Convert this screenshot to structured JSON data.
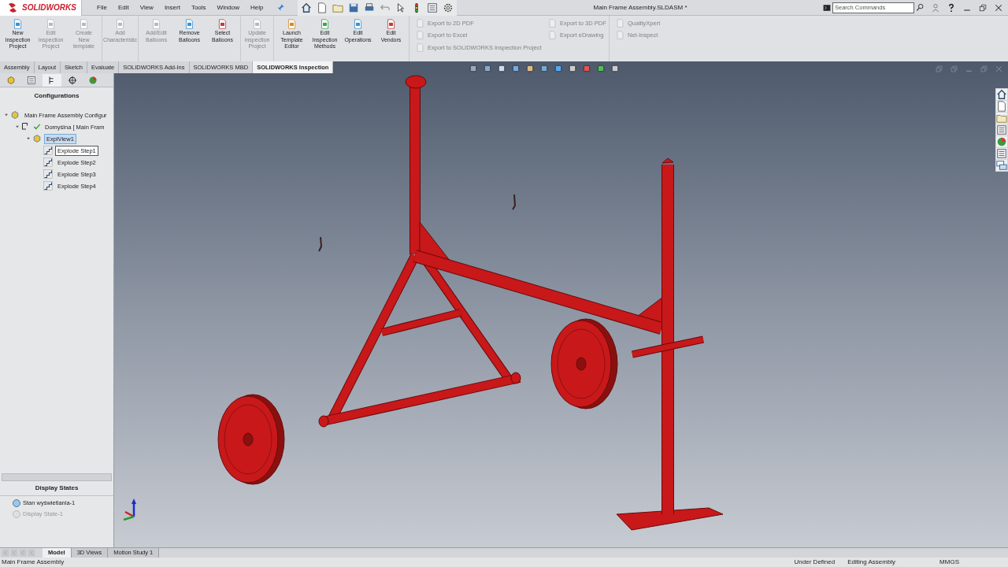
{
  "logo": "SOLIDWORKS",
  "menu": [
    "File",
    "Edit",
    "View",
    "Insert",
    "Tools",
    "Window",
    "Help"
  ],
  "title": "Main Frame Assembly.SLDASM *",
  "search": {
    "placeholder": "Search Commands"
  },
  "ribbon": {
    "buttons": [
      {
        "label": "New\nInspection\nProject",
        "disabled": false
      },
      {
        "label": "Edit\nInspection\nProject",
        "disabled": true
      },
      {
        "label": "Create\nNew\ntemplate",
        "disabled": true
      },
      {
        "label": "Add\nCharacteristic",
        "disabled": true
      },
      {
        "label": "Add/Edit\nBalloons",
        "disabled": true
      },
      {
        "label": "Remove\nBalloons",
        "disabled": false
      },
      {
        "label": "Select\nBalloons",
        "disabled": false
      },
      {
        "label": "Update\nInspection\nProject",
        "disabled": true
      },
      {
        "label": "Launch\nTemplate\nEditor",
        "disabled": false
      },
      {
        "label": "Edit\nInspection\nMethods",
        "disabled": false
      },
      {
        "label": "Edit\nOperations",
        "disabled": false
      },
      {
        "label": "Edit\nVendors",
        "disabled": false
      }
    ],
    "columns": [
      [
        {
          "label": "Export to 2D PDF",
          "disabled": true
        },
        {
          "label": "Export to Excel",
          "disabled": true
        },
        {
          "label": "Export to SOLIDWORKS Inspection Project",
          "disabled": true
        }
      ],
      [
        {
          "label": "Export to 3D PDF",
          "disabled": true
        },
        {
          "label": "Export eDrawing",
          "disabled": true
        }
      ],
      [
        {
          "label": "QualityXpert",
          "disabled": true
        },
        {
          "label": "Net-Inspect",
          "disabled": true
        }
      ]
    ]
  },
  "tabs": [
    {
      "label": "Assembly",
      "selected": false
    },
    {
      "label": "Layout",
      "selected": false
    },
    {
      "label": "Sketch",
      "selected": false
    },
    {
      "label": "Evaluate",
      "selected": false
    },
    {
      "label": "SOLIDWORKS Add-Ins",
      "selected": false
    },
    {
      "label": "SOLIDWORKS MBD",
      "selected": false
    },
    {
      "label": "SOLIDWORKS Inspection",
      "selected": true
    }
  ],
  "panel": {
    "tabs": [
      {
        "selected": false
      },
      {
        "selected": false
      },
      {
        "selected": true
      },
      {
        "selected": false
      },
      {
        "selected": false
      }
    ],
    "title": "Configurations",
    "tree": [
      {
        "label": "Main Frame Assembly Configur",
        "selected": false,
        "outlined": false,
        "children": [
          {
            "label": "Domyślna [ Main Fram",
            "selected": false,
            "outlined": false,
            "checked": true,
            "children": [
              {
                "label": "ExplView1",
                "selected": true,
                "outlined": false,
                "children": [
                  {
                    "label": "Explode Step1",
                    "selected": false,
                    "outlined": true
                  },
                  {
                    "label": "Explode Step2",
                    "selected": false,
                    "outlined": false
                  },
                  {
                    "label": "Explode Step3",
                    "selected": false,
                    "outlined": false
                  },
                  {
                    "label": "Explode Step4",
                    "selected": false,
                    "outlined": false
                  }
                ]
              }
            ]
          }
        ]
      }
    ],
    "display_states_title": "Display States",
    "display_states": [
      {
        "label": "Stan wyświetlania-1",
        "disabled": false
      },
      {
        "label": "Display State-1",
        "disabled": true
      }
    ]
  },
  "bottom_tabs": [
    {
      "label": "Model",
      "selected": true
    },
    {
      "label": "3D Views",
      "selected": false
    },
    {
      "label": "Motion Study 1",
      "selected": false
    }
  ],
  "status_bar": {
    "left": "Main Frame Assembly",
    "items": [
      "Under Defined",
      "Editing Assembly",
      "MMGS"
    ]
  }
}
